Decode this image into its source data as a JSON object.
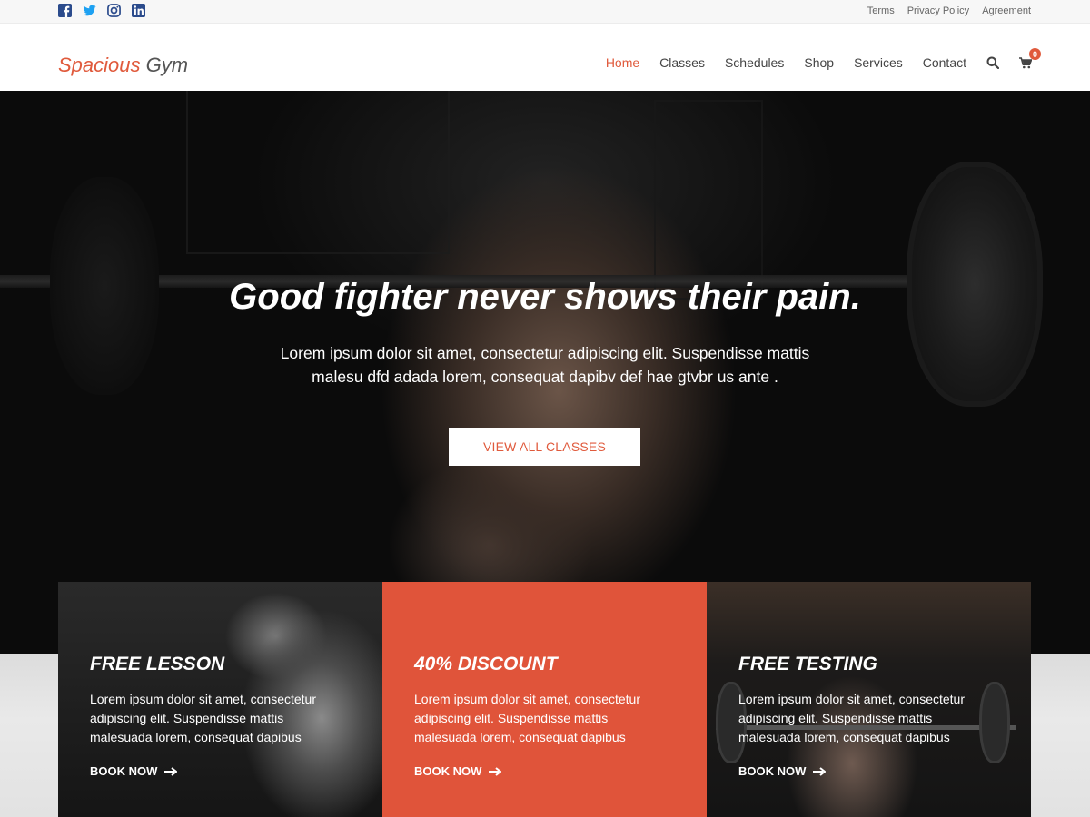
{
  "topbar": {
    "social": [
      "facebook-icon",
      "twitter-icon",
      "instagram-icon",
      "linkedin-icon"
    ],
    "links": [
      "Terms",
      "Privacy Policy",
      "Agreement"
    ]
  },
  "header": {
    "logo_part1": "Spacious",
    "logo_part2": "Gym",
    "nav": [
      "Home",
      "Classes",
      "Schedules",
      "Shop",
      "Services",
      "Contact"
    ],
    "cart_count": "0"
  },
  "hero": {
    "title": "Good fighter never shows their pain.",
    "text": "Lorem ipsum dolor sit amet, consectetur adipiscing elit. Suspendisse mattis malesu dfd adada lorem, consequat dapibv def hae gtvbr us ante .",
    "cta": "VIEW ALL CLASSES"
  },
  "cards": [
    {
      "title": "FREE LESSON",
      "text": "Lorem ipsum dolor sit amet, consectetur adipiscing elit. Suspendisse mattis malesuada lorem, consequat dapibus",
      "link": "BOOK NOW"
    },
    {
      "title": "40% DISCOUNT",
      "text": "Lorem ipsum dolor sit amet, consectetur adipiscing elit. Suspendisse mattis malesuada lorem, consequat dapibus",
      "link": "BOOK NOW"
    },
    {
      "title": "FREE TESTING",
      "text": "Lorem ipsum dolor sit amet, consectetur adipiscing elit. Suspendisse mattis malesuada lorem, consequat dapibus",
      "link": "BOOK NOW"
    }
  ],
  "colors": {
    "accent": "#e05a3c",
    "social": "#2b4b8c",
    "twitter": "#1da1f2"
  }
}
